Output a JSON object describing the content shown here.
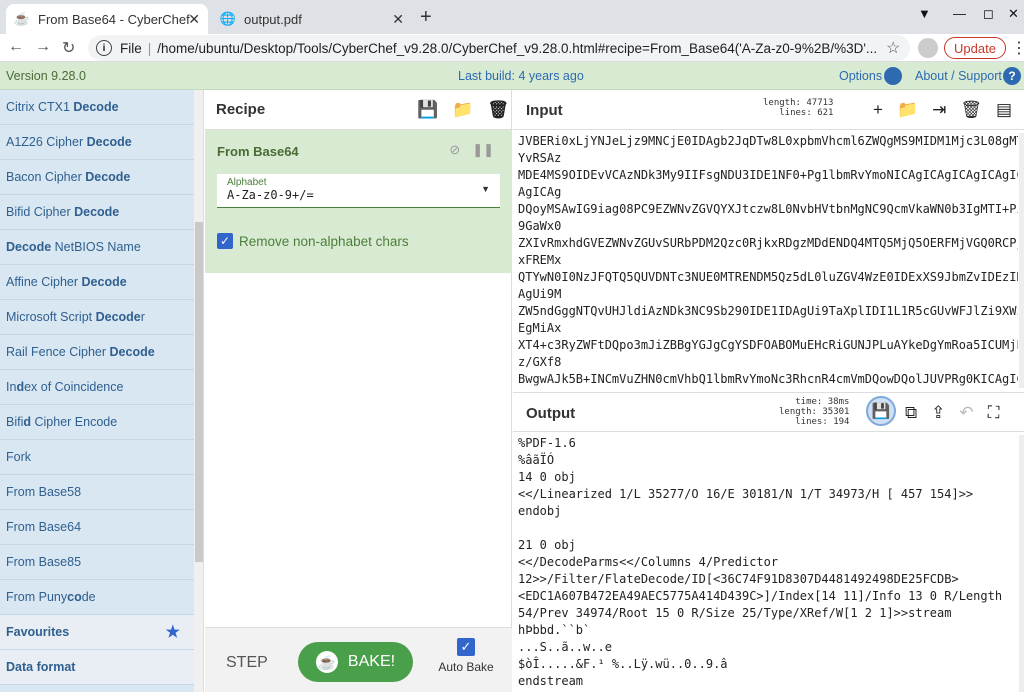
{
  "browser": {
    "tabs": [
      {
        "title": "From Base64 - CyberChef",
        "icon": "cyberchef-icon",
        "active": true
      },
      {
        "title": "output.pdf",
        "icon": "globe-icon",
        "active": false
      }
    ],
    "url_label": "File",
    "url": "/home/ubuntu/Desktop/Tools/CyberChef_v9.28.0/CyberChef_v9.28.0.html#recipe=From_Base64('A-Za-z0-9%2B/%3D'...",
    "update_label": "Update"
  },
  "topbar": {
    "version": "Version 9.28.0",
    "last_build": "Last build: 4 years ago",
    "options": "Options",
    "about": "About / Support"
  },
  "operations": [
    {
      "pre": "Citrix CTX1 ",
      "bold": "Decode",
      "post": ""
    },
    {
      "pre": "A1Z26 Cipher ",
      "bold": "Decode",
      "post": ""
    },
    {
      "pre": "Bacon Cipher ",
      "bold": "Decode",
      "post": ""
    },
    {
      "pre": "Bifid Cipher ",
      "bold": "Decode",
      "post": ""
    },
    {
      "pre": "",
      "bold": "Decode",
      "post": " NetBIOS Name"
    },
    {
      "pre": "Affine Cipher ",
      "bold": "Decode",
      "post": ""
    },
    {
      "pre": "Microsoft Script ",
      "bold": "Decode",
      "post": "r"
    },
    {
      "pre": "Rail Fence Cipher ",
      "bold": "Decode",
      "post": ""
    },
    {
      "pre": "In",
      "bold": "d",
      "post": "ex of Coincidence"
    },
    {
      "pre": "Bifi",
      "bold": "d",
      "post": " Cipher Encode"
    },
    {
      "pre": "Fork",
      "bold": "",
      "post": ""
    },
    {
      "pre": "From Base58",
      "bold": "",
      "post": ""
    },
    {
      "pre": "From Base64",
      "bold": "",
      "post": ""
    },
    {
      "pre": "From Base85",
      "bold": "",
      "post": ""
    },
    {
      "pre": "From Puny",
      "bold": "co",
      "post": "de"
    }
  ],
  "categories": [
    "Favourites",
    "Data format"
  ],
  "recipe": {
    "title": "Recipe",
    "operation": "From Base64",
    "alphabet_label": "Alphabet",
    "alphabet_value": "A-Za-z0-9+/=",
    "remove_label": "Remove non-alphabet chars",
    "step": "STEP",
    "bake": "BAKE!",
    "auto_bake": "Auto Bake"
  },
  "input": {
    "title": "Input",
    "length_label": "length:",
    "length": "47713",
    "lines_label": "lines:",
    "lines": "621",
    "text": [
      "JVBERi0xLjYNJeLjz9MNCjE0IDAgb2JqDTw8L0xpbmVhcml6ZWQgMS9MIDM1Mjc3L08gMT",
      "YvRSAz",
      "MDE4MS9OIDEvVCAzNDk3My9IIFsgNDU3IDE1NF0+Pg1lbmRvYmoNICAgICAgICAgICAgIC",
      "AgICAg",
      "DQoyMSAwIG9iag08PC9EZWNvZGVQYXJtczw8L0NvbHVtbnMgNC9QcmVkaWN0b3IgMTI+Pi",
      "9GaWx0",
      "ZXIvRmxhdGVEZWNvZGUvSURbPDM2Qzc0RjkxRDgzMDdENDQ4MTQ5MjQ5OERFMjVGQ0RCPj",
      "xFREMx",
      "QTYwN0I0NzJFQTQ5QUVDNTc3NUE0MTRENDM5Qz5dL0luZGV4WzE0IDExXS9JbmZvIDEzID",
      "AgUi9M",
      "ZW5ndGggNTQvUHJldiAzNDk3NC9Sb290IDE1IDAgUi9TaXplIDI1L1R5cGUvWFJlZi9XWz",
      "EgMiAx",
      "XT4+c3RyZWFtDQpo3mJiZBBgYGJgCgYSDFOABOMuEHcRiGUNJPLuAYkeDgYmRoa5ICUMjE",
      "z/GXf8",
      "BwgwAJk5B+INCmVuZHN0cmVhbQ1lbmRvYmoNc3RhcnR4cmVmDQowDQolJUVPRg0KICAgIC"
    ]
  },
  "output": {
    "title": "Output",
    "time_label": "time:",
    "time": "38ms",
    "length_label": "length:",
    "length": "35301",
    "lines_label": "lines:",
    "lines": "194",
    "text": [
      "%PDF-1.6",
      "%âãÏÓ",
      "14 0 obj",
      "<</Linearized 1/L 35277/O 16/E 30181/N 1/T 34973/H [ 457 154]>>",
      "endobj",
      "",
      "21 0 obj",
      "<</DecodeParms<</Columns 4/Predictor",
      "12>>/Filter/FlateDecode/ID[<36C74F91D8307D4481492498DE25FCDB>",
      "<EDC1A607B472EA49AEC5775A414D439C>]/Index[14 11]/Info 13 0 R/Length",
      "54/Prev 34974/Root 15 0 R/Size 25/Type/XRef/W[1 2 1]>>stream",
      "hÞbbd.``b`",
      "...S..ã..w..e",
      "$òÎ.....&F.¹ %..Lÿ.wü..0..9.â",
      "endstream"
    ]
  },
  "colors": {
    "accent_green": "#d8ebd2",
    "link_blue": "#2e6ab0",
    "bake_green": "#4aa04a"
  }
}
